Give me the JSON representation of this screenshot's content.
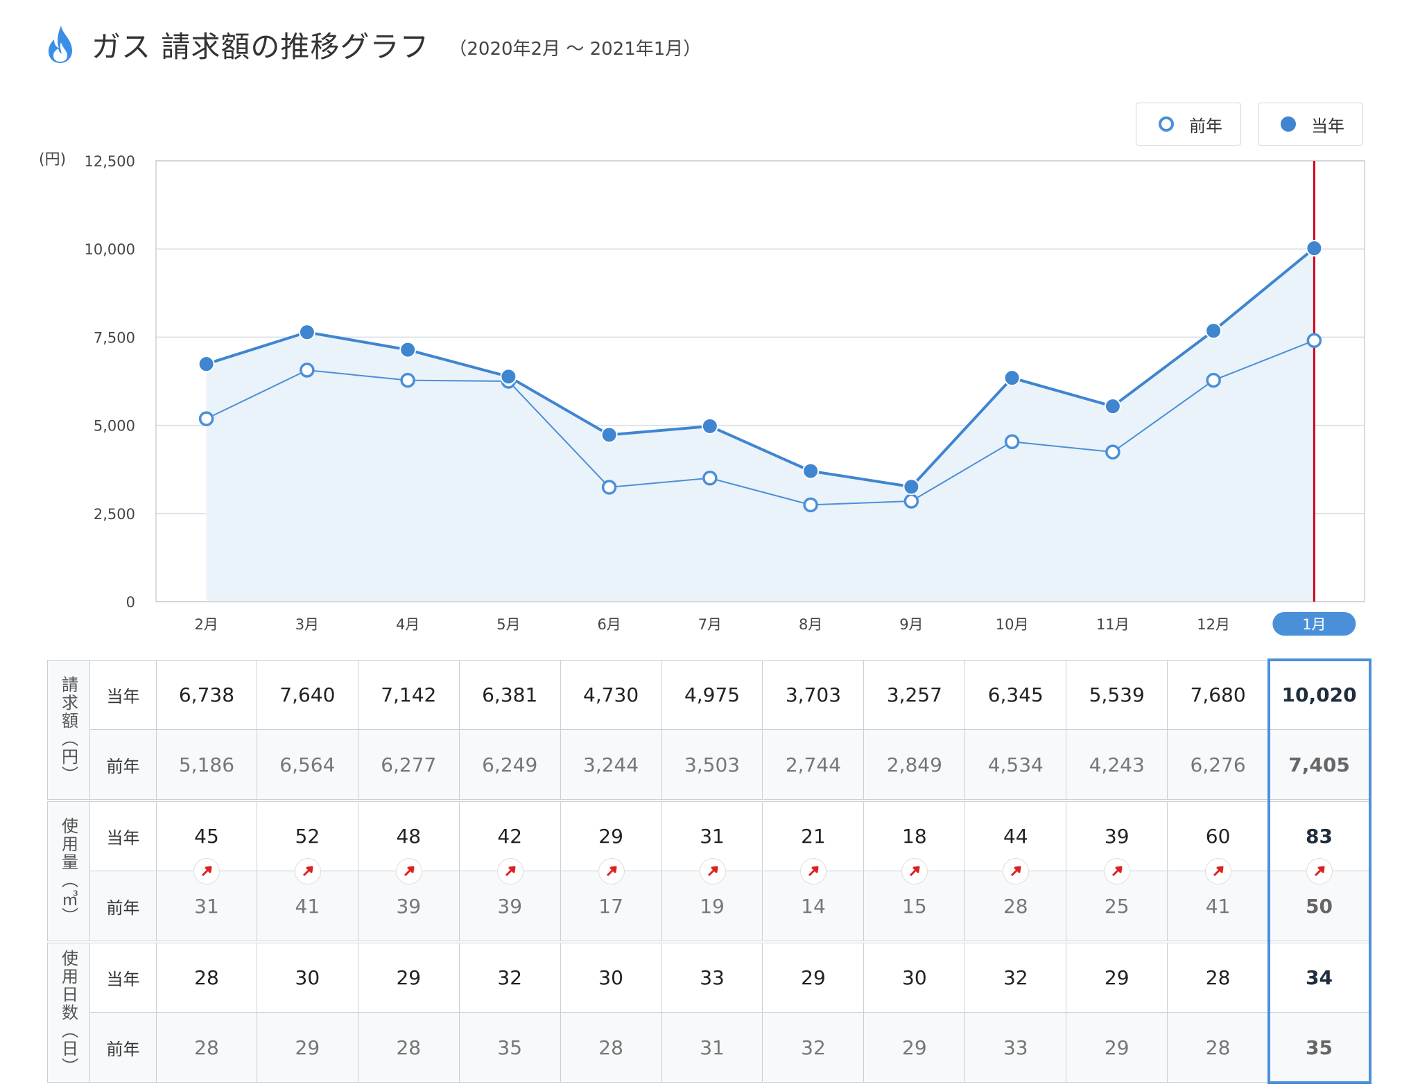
{
  "header": {
    "title": "ガス 請求額の推移グラフ",
    "period": "（2020年2月 〜 2021年1月）",
    "icon": "gas-flame-icon"
  },
  "legend": {
    "prev_label": "前年",
    "curr_label": "当年"
  },
  "colors": {
    "current": "#3f85d0",
    "previous": "#4a8fd9",
    "area": "#eaf2fa",
    "marker_line": "#d0021b",
    "highlight": "#4a90d9",
    "arrow": "#e02020"
  },
  "chart_data": {
    "type": "line",
    "ylabel": "(円)",
    "ylim": [
      0,
      12500
    ],
    "yticks": [
      "0",
      "2,500",
      "5,000",
      "7,500",
      "10,000",
      "12,500"
    ],
    "categories": [
      "2月",
      "3月",
      "4月",
      "5月",
      "6月",
      "7月",
      "8月",
      "9月",
      "10月",
      "11月",
      "12月",
      "1月"
    ],
    "highlight_category": "1月",
    "grid": true,
    "legend_position": "top-right",
    "series": [
      {
        "name": "前年",
        "values": [
          5186,
          6564,
          6277,
          6249,
          3244,
          3503,
          2744,
          2849,
          4534,
          4243,
          6276,
          7405
        ]
      },
      {
        "name": "当年",
        "values": [
          6738,
          7640,
          7142,
          6381,
          4730,
          4975,
          3703,
          3257,
          6345,
          5539,
          7680,
          10020
        ]
      }
    ]
  },
  "table": {
    "row_labels": {
      "curr": "当年",
      "prev": "前年"
    },
    "groups": [
      {
        "label": "請求額（円）",
        "curr": [
          "6,738",
          "7,640",
          "7,142",
          "6,381",
          "4,730",
          "4,975",
          "3,703",
          "3,257",
          "6,345",
          "5,539",
          "7,680",
          "10,020"
        ],
        "prev": [
          "5,186",
          "6,564",
          "6,277",
          "6,249",
          "3,244",
          "3,503",
          "2,744",
          "2,849",
          "4,534",
          "4,243",
          "6,276",
          "7,405"
        ]
      },
      {
        "label": "使用量（㎥）",
        "curr": [
          "45",
          "52",
          "48",
          "42",
          "29",
          "31",
          "21",
          "18",
          "44",
          "39",
          "60",
          "83"
        ],
        "prev": [
          "31",
          "41",
          "39",
          "39",
          "17",
          "19",
          "14",
          "15",
          "28",
          "25",
          "41",
          "50"
        ],
        "trend_icon": "arrow-up-right-icon"
      },
      {
        "label": "使用日数（日）",
        "curr": [
          "28",
          "30",
          "29",
          "32",
          "30",
          "33",
          "29",
          "30",
          "32",
          "29",
          "28",
          "34"
        ],
        "prev": [
          "28",
          "29",
          "28",
          "35",
          "28",
          "31",
          "32",
          "29",
          "33",
          "29",
          "28",
          "35"
        ]
      }
    ]
  }
}
